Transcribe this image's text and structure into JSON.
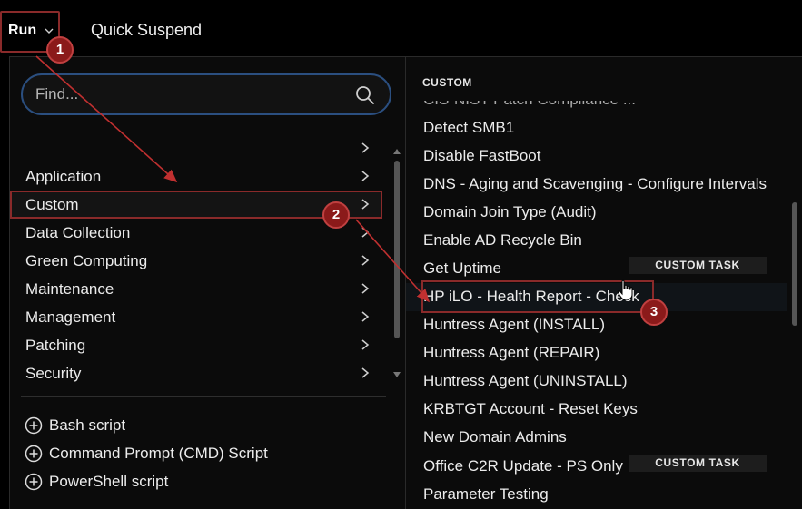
{
  "topbar": {
    "run_label": "Run",
    "quick_suspend_label": "Quick Suspend"
  },
  "search": {
    "placeholder": "Find..."
  },
  "categories": [
    {
      "label": ""
    },
    {
      "label": "Application"
    },
    {
      "label": "Custom"
    },
    {
      "label": "Data Collection"
    },
    {
      "label": "Green Computing"
    },
    {
      "label": "Maintenance"
    },
    {
      "label": "Management"
    },
    {
      "label": "Patching"
    },
    {
      "label": "Security"
    }
  ],
  "add_scripts": [
    {
      "label": "Bash script"
    },
    {
      "label": "Command Prompt (CMD) Script"
    },
    {
      "label": "PowerShell script"
    }
  ],
  "custom": {
    "header": "CUSTOM",
    "tasks": [
      {
        "label": "CIS-NIST Patch Compliance ..."
      },
      {
        "label": "Detect SMB1"
      },
      {
        "label": "Disable FastBoot"
      },
      {
        "label": "DNS - Aging and Scavenging - Configure Intervals"
      },
      {
        "label": "Domain Join Type (Audit)"
      },
      {
        "label": "Enable AD Recycle Bin"
      },
      {
        "label": "Get Uptime",
        "badge": "CUSTOM TASK"
      },
      {
        "label": "HP iLO - Health Report - Check"
      },
      {
        "label": "Huntress Agent (INSTALL)"
      },
      {
        "label": "Huntress Agent (REPAIR)"
      },
      {
        "label": "Huntress Agent (UNINSTALL)"
      },
      {
        "label": "KRBTGT Account - Reset Keys"
      },
      {
        "label": "New Domain Admins"
      },
      {
        "label": "Office C2R Update - PS Only",
        "badge": "CUSTOM TASK"
      },
      {
        "label": "Parameter Testing"
      }
    ]
  },
  "callouts": [
    "1",
    "2",
    "3"
  ],
  "colors": {
    "background": "#000000",
    "annotation_red": "#8b1a1a",
    "search_border": "#2b4f80"
  }
}
